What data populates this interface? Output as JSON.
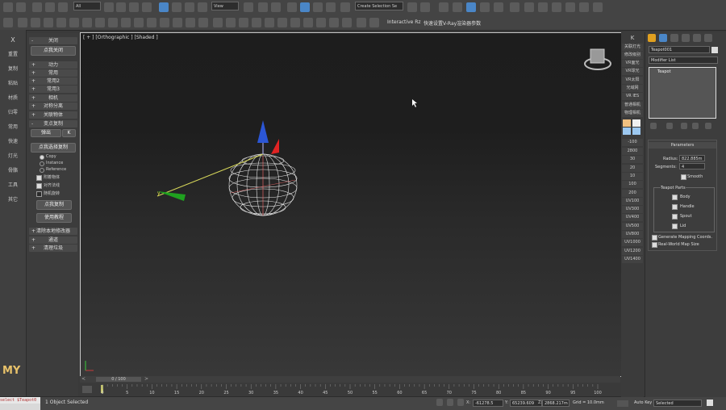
{
  "toolbar1": {
    "filter_value": "All",
    "view_value": "View",
    "selection_set_placeholder": "Create Selection Se",
    "icons": [
      "undo-icon",
      "redo-icon",
      "link-icon",
      "unlink-icon",
      "bind-spacewarp-icon",
      "select-icon",
      "select-by-name-icon",
      "rect-select-icon",
      "window-crossing-icon",
      "move-icon",
      "rotate-icon",
      "scale-icon",
      "snap-icon",
      "angle-snap-icon",
      "percent-snap-icon",
      "spinner-snap-icon",
      "mirror-icon",
      "align-icon",
      "layer-icon",
      "curve-editor-icon",
      "schematic-icon",
      "material-editor-icon",
      "render-setup-icon",
      "render-frame-icon",
      "render-icon"
    ]
  },
  "toolbar2": {
    "interactive_label": "Interactive Rz",
    "vray_quick_label": "快速设置V-Ray渲染器参数"
  },
  "left_strip": {
    "items": [
      "X",
      "重置",
      "复制",
      "粘贴",
      "材质",
      "归零",
      "常用",
      "快速",
      "灯光",
      "骨骼",
      "工具",
      "其它"
    ],
    "logo": "MY"
  },
  "left_panel": {
    "rollouts_top": [
      {
        "sign": "-",
        "label": "关闭"
      },
      {
        "sign": "",
        "label": "点我关闭"
      },
      {
        "sign": "+",
        "label": "动力"
      },
      {
        "sign": "+",
        "label": "常用"
      },
      {
        "sign": "+",
        "label": "常用2"
      },
      {
        "sign": "+",
        "label": "常用3"
      },
      {
        "sign": "+",
        "label": "相机"
      },
      {
        "sign": "+",
        "label": "对称分离"
      },
      {
        "sign": "+",
        "label": "关联物体"
      },
      {
        "sign": "-",
        "label": "变点复制"
      }
    ],
    "popout_label": "弹出",
    "popout_key": "K",
    "select_copy_button": "点我选择复制",
    "radio_options": [
      "Copy",
      "Instance",
      "Reference"
    ],
    "checkboxes": [
      {
        "label": "附着物体",
        "checked": true
      },
      {
        "label": "对齐法线",
        "checked": true
      },
      {
        "label": "随机旋转",
        "checked": false
      }
    ],
    "point_copy_button": "点我复制",
    "tutorial_button": "使用教程",
    "rollouts_bottom": [
      {
        "sign": "+",
        "label": "清除本地修改器"
      },
      {
        "sign": "+",
        "label": "通道"
      },
      {
        "sign": "+",
        "label": "清理垃圾"
      }
    ]
  },
  "viewport": {
    "label": "[ + ] [Orthographic ] [Shaded ]",
    "axis_y": "y"
  },
  "timeline": {
    "slider_label": "0 / 100",
    "ticks": [
      "0",
      "5",
      "10",
      "15",
      "20",
      "25",
      "30",
      "35",
      "40",
      "45",
      "50",
      "55",
      "60",
      "65",
      "70",
      "75",
      "80",
      "85",
      "90",
      "95",
      "100"
    ]
  },
  "status_bar": {
    "maxscript_text": "select $Teapot0",
    "selection_text": "1 Object Selected",
    "x_label": "X:",
    "x_value": "-61278.5",
    "y_label": "Y:",
    "y_value": "65239.609",
    "z_label": "Z:",
    "z_value": "2868.217m",
    "grid_text": "Grid = 10.0mm",
    "auto_key": "Auto Key",
    "selected_value": "Selected"
  },
  "vray_panel": {
    "top": "K",
    "items": [
      "关联灯光",
      "修改级别",
      "VR面光",
      "VR球光",
      "VR太阳",
      "光域网",
      "VR IES",
      "普通相机",
      "物理相机"
    ],
    "numbers": [
      "-100",
      "2800",
      "30",
      "20",
      "10",
      "100",
      "200",
      "UV100",
      "UV300",
      "UV400",
      "UV500",
      "UV800",
      "UV1000",
      "UV1200",
      "UV1400"
    ]
  },
  "command_panel": {
    "object_name": "Teapot001",
    "modifier_list": "Modifier List",
    "stack_item": "Teapot",
    "params_title": "Parameters",
    "radius_label": "Radius:",
    "radius_value": "822.885m",
    "segments_label": "Segments:",
    "segments_value": "4",
    "smooth_label": "Smooth",
    "parts_title": "Teapot Parts",
    "parts": [
      "Body",
      "Handle",
      "Spout",
      "Lid"
    ],
    "mapping_label": "Generate Mapping Coords.",
    "realworld_label": "Real-World Map Size",
    "color_swatch": "#dcdcdc"
  }
}
